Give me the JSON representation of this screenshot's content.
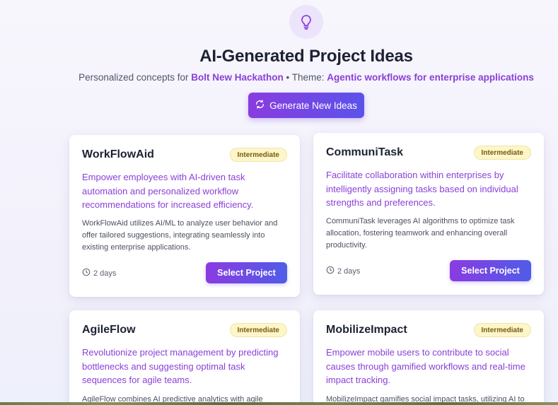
{
  "header": {
    "title": "AI-Generated Project Ideas",
    "subtitle_prefix": "Personalized concepts for",
    "hackathon": "Bolt New Hackathon",
    "separator": "• Theme:",
    "theme": "Agentic workflows for enterprise applications",
    "icon": "lightbulb-icon"
  },
  "generate_button": {
    "label": "Generate New Ideas",
    "icon": "refresh-icon"
  },
  "colors": {
    "accent": "#8a3fd8",
    "badge_bg": "#fcf6c9",
    "badge_text": "#7a5a12"
  },
  "cards": [
    {
      "name": "WorkFlowAid",
      "badge": "Intermediate",
      "tagline": "Empower employees with AI-driven task automation and personalized workflow recommendations for increased efficiency.",
      "description": "WorkFlowAid utilizes AI/ML to analyze user behavior and offer tailored suggestions, integrating seamlessly into existing enterprise applications.",
      "duration": "2 days",
      "button": "Select Project"
    },
    {
      "name": "CommuniTask",
      "badge": "Intermediate",
      "tagline": "Facilitate collaboration within enterprises by intelligently assigning tasks based on individual strengths and preferences.",
      "description": "CommuniTask leverages AI algorithms to optimize task allocation, fostering teamwork and enhancing overall productivity.",
      "duration": "2 days",
      "button": "Select Project"
    },
    {
      "name": "AgileFlow",
      "badge": "Intermediate",
      "tagline": "Revolutionize project management by predicting bottlenecks and suggesting optimal task sequences for agile teams.",
      "description": "AgileFlow combines AI predictive analytics with agile"
    },
    {
      "name": "MobilizeImpact",
      "badge": "Intermediate",
      "tagline": "Empower mobile users to contribute to social causes through gamified workflows and real-time impact tracking.",
      "description": "MobilizeImpact gamifies social impact tasks, utilizing AI to"
    }
  ]
}
